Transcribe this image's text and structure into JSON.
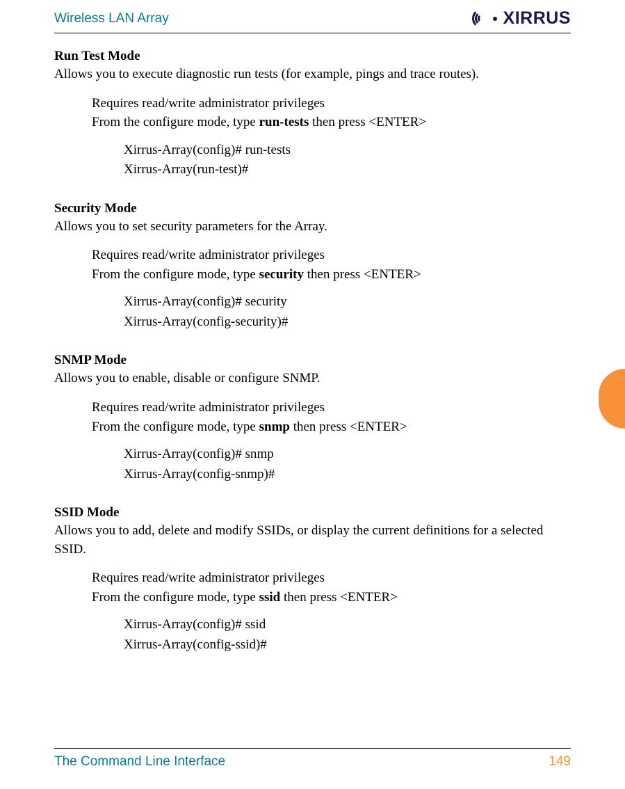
{
  "header": {
    "title": "Wireless LAN Array",
    "logo_text": "XIRRUS"
  },
  "sections": [
    {
      "heading": "Run Test Mode",
      "desc": "Allows you to execute diagnostic run tests (for example, pings and trace routes).",
      "req": "Requires read/write administrator privileges",
      "from_prefix": "From the configure mode, type ",
      "cmd": "run-tests",
      "from_suffix": " then press <ENTER>",
      "cli1": "Xirrus-Array(config)# run-tests",
      "cli2": "Xirrus-Array(run-test)#"
    },
    {
      "heading": "Security Mode",
      "desc": "Allows you to set security parameters for the Array.",
      "req": "Requires read/write administrator privileges",
      "from_prefix": "From the configure mode, type ",
      "cmd": "security",
      "from_suffix": " then press <ENTER>",
      "cli1": "Xirrus-Array(config)# security",
      "cli2": "Xirrus-Array(config-security)#"
    },
    {
      "heading": "SNMP Mode",
      "desc": "Allows you to enable, disable or configure SNMP.",
      "req": "Requires read/write administrator privileges",
      "from_prefix": "From the configure mode, type ",
      "cmd": "snmp",
      "from_suffix": " then press <ENTER>",
      "cli1": "Xirrus-Array(config)# snmp",
      "cli2": "Xirrus-Array(config-snmp)#"
    },
    {
      "heading": "SSID Mode",
      "desc": "Allows you to add, delete and modify SSIDs, or display the current definitions for a selected SSID.",
      "req": "Requires read/write administrator privileges",
      "from_prefix": "From the configure mode, type ",
      "cmd": "ssid",
      "from_suffix": " then press <ENTER>",
      "cli1": "Xirrus-Array(config)# ssid",
      "cli2": "Xirrus-Array(config-ssid)#"
    }
  ],
  "footer": {
    "title": "The Command Line Interface",
    "page": "149"
  }
}
